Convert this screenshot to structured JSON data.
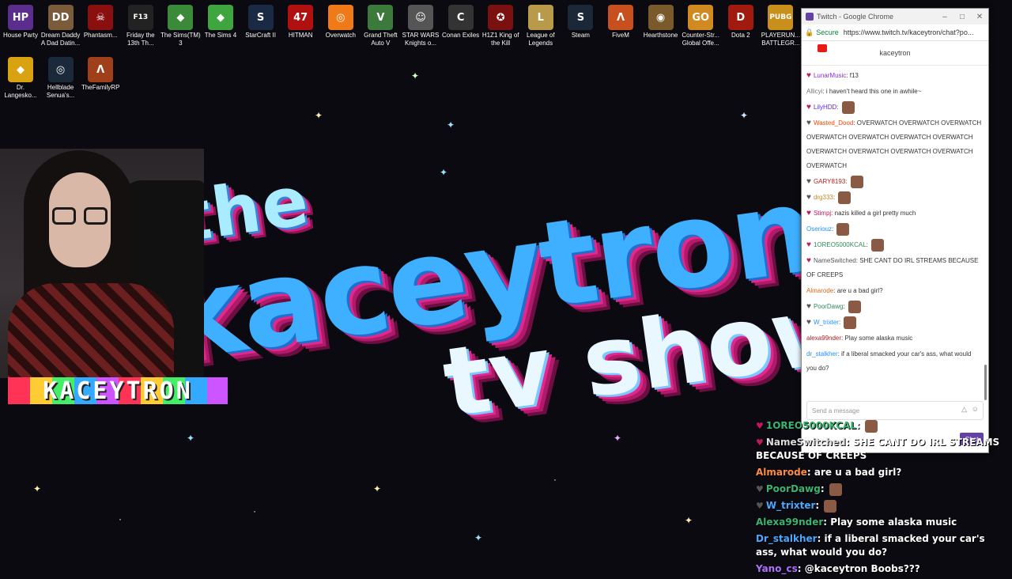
{
  "desktop": {
    "icons": [
      {
        "label": "House Party",
        "glyph": "HP",
        "color": "#5b2d8c"
      },
      {
        "label": "Dream Daddy A Dad Datin...",
        "glyph": "DD",
        "color": "#7a5b3a"
      },
      {
        "label": "Phantasm...",
        "glyph": "☠",
        "color": "#8a1010"
      },
      {
        "label": "Friday the 13th Th...",
        "glyph": "F13",
        "color": "#222"
      },
      {
        "label": "The Sims(TM) 3",
        "glyph": "◆",
        "color": "#3a8a3a"
      },
      {
        "label": "The Sims 4",
        "glyph": "◆",
        "color": "#3fa53f"
      },
      {
        "label": "StarCraft II",
        "glyph": "S",
        "color": "#1b2a44"
      },
      {
        "label": "HITMAN",
        "glyph": "47",
        "color": "#b01010"
      },
      {
        "label": "Overwatch",
        "glyph": "◎",
        "color": "#f07a18"
      },
      {
        "label": "Grand Theft Auto V",
        "glyph": "V",
        "color": "#3b7a3b"
      },
      {
        "label": "STAR WARS Knights o...",
        "glyph": "☺",
        "color": "#555"
      },
      {
        "label": "Conan Exiles",
        "glyph": "C",
        "color": "#333"
      },
      {
        "label": "H1Z1 King of the Kill",
        "glyph": "✪",
        "color": "#7a1010"
      },
      {
        "label": "League of Legends",
        "glyph": "L",
        "color": "#b89a4a"
      },
      {
        "label": "Steam",
        "glyph": "S",
        "color": "#1b2838"
      },
      {
        "label": "FiveM",
        "glyph": "Λ",
        "color": "#c8501e"
      },
      {
        "label": "Hearthstone",
        "glyph": "◉",
        "color": "#7a5a2a"
      },
      {
        "label": "Counter-Str... Global Offe...",
        "glyph": "GO",
        "color": "#d08a20"
      },
      {
        "label": "Dota 2",
        "glyph": "D",
        "color": "#a01a10"
      },
      {
        "label": "PLAYERUN... BATTLEGR...",
        "glyph": "PUBG",
        "color": "#c8901a"
      },
      {
        "label": "Dr. Langesko...",
        "glyph": "◆",
        "color": "#d8a210"
      },
      {
        "label": "Hellblade Senua's...",
        "glyph": "◎",
        "color": "#1a2a3a"
      },
      {
        "label": "TheFamilyRP",
        "glyph": "Λ",
        "color": "#a0401a"
      }
    ]
  },
  "logo": {
    "line1": "the",
    "line2": "kaceytron",
    "line3": "tv show"
  },
  "webcam": {
    "name_overlay": "KACEYTRON"
  },
  "browser": {
    "tab_title": "Twitch - Google Chrome",
    "secure_label": "Secure",
    "url": "https://www.twitch.tv/kaceytron/chat?po...",
    "channel": "kaceytron",
    "input_placeholder": "Send a message",
    "chat_button": "Chat",
    "messages": [
      {
        "user": "LunarMusic",
        "color": "#8a2be2",
        "text": "f13",
        "heart": "pink"
      },
      {
        "user": "Allicyi",
        "color": "#777777",
        "text": "i haven't heard this one in awhile~",
        "heart": ""
      },
      {
        "user": "LilyHDD",
        "color": "#5a2be2",
        "text": "",
        "heart": "pink"
      },
      {
        "user": "Wasted_Dood",
        "color": "#ff4500",
        "text": "OVERWATCH OVERWATCH OVERWATCH OVERWATCH OVERWATCH OVERWATCH OVERWATCH OVERWATCH OVERWATCH OVERWATCH OVERWATCH OVERWATCH",
        "heart": "grey"
      },
      {
        "user": "GARY8193",
        "color": "#b22222",
        "text": "",
        "heart": "grey"
      },
      {
        "user": "drg333",
        "color": "#c08a2a",
        "text": "",
        "heart": "grey"
      },
      {
        "user": "Stimpj",
        "color": "#c0185a",
        "text": "nazis killed a girl pretty much",
        "heart": "pink"
      },
      {
        "user": "Oseriouz",
        "color": "#1e90ff",
        "text": "",
        "heart": ""
      },
      {
        "user": "1OREO5000KCAL",
        "color": "#2e8b57",
        "text": "",
        "heart": "pink"
      },
      {
        "user": "NameSwitched",
        "color": "#555555",
        "text": "SHE CANT DO IRL STREAMS BECAUSE OF CREEPS",
        "heart": "pink"
      },
      {
        "user": "Almarode",
        "color": "#d2691e",
        "text": "are u a bad girl?",
        "heart": ""
      },
      {
        "user": "PoorDawg",
        "color": "#2e8b57",
        "text": "",
        "heart": "grey"
      },
      {
        "user": "W_trixter",
        "color": "#1e90ff",
        "text": "",
        "heart": "grey"
      },
      {
        "user": "alexa99nder",
        "color": "#b22222",
        "text": "Play some alaska music",
        "heart": ""
      },
      {
        "user": "dr_stalkher",
        "color": "#1e90ff",
        "text": "if a liberal smacked your car's ass, what would you do?",
        "heart": ""
      }
    ]
  },
  "overlay_chat": {
    "messages": [
      {
        "user": "1OREO5000KCAL",
        "color": "#3cb371",
        "text": "",
        "heart": "pink"
      },
      {
        "user": "NameSwitched",
        "color": "#dddddd",
        "text": "SHE CANT DO IRL STREAMS BECAUSE OF CREEPS",
        "heart": "pink"
      },
      {
        "user": "Almarode",
        "color": "#ff8c40",
        "text": "are u a bad girl?",
        "heart": ""
      },
      {
        "user": "PoorDawg",
        "color": "#3cb371",
        "text": "",
        "heart": "grey"
      },
      {
        "user": "W_trixter",
        "color": "#4aa8ff",
        "text": "",
        "heart": "grey"
      },
      {
        "user": "Alexa99nder",
        "color": "#3cb371",
        "text": "Play some alaska music",
        "heart": ""
      },
      {
        "user": "Dr_stalkher",
        "color": "#4aa8ff",
        "text": "if a liberal smacked your car's ass, what would you do?",
        "heart": ""
      },
      {
        "user": "Yano_cs",
        "color": "#b070ff",
        "text": "@kaceytron Boobs???",
        "heart": ""
      }
    ]
  }
}
